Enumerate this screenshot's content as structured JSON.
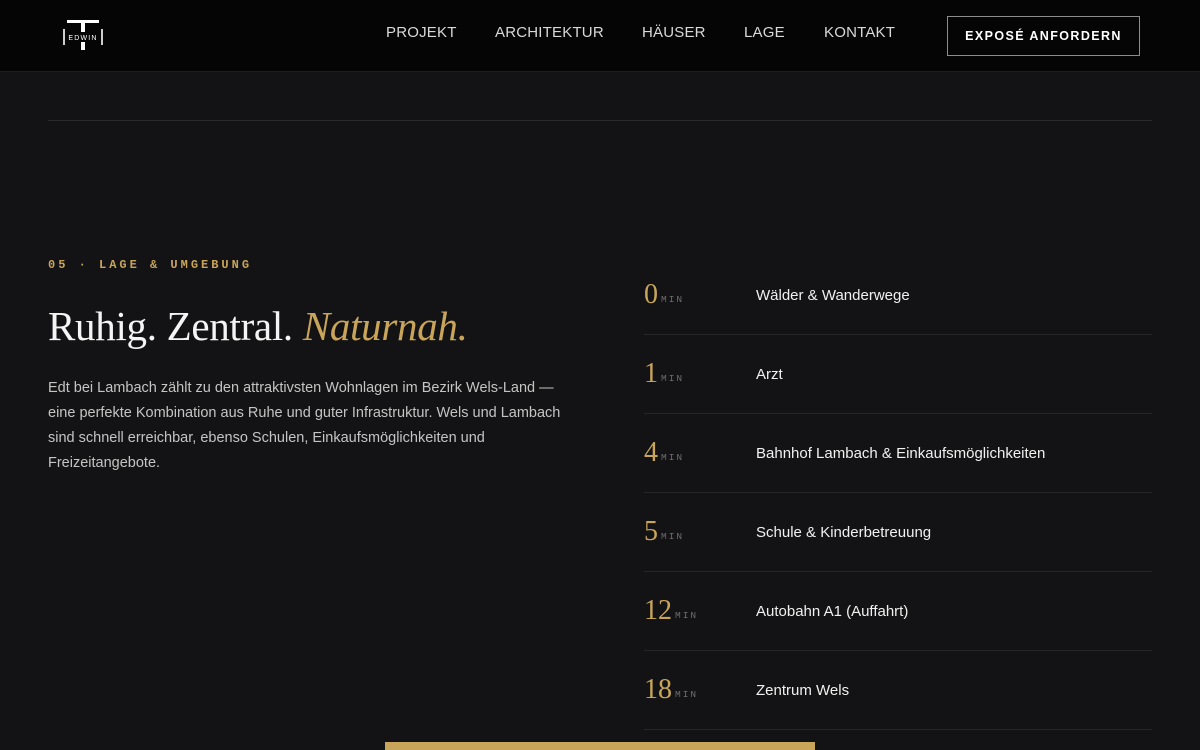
{
  "header": {
    "logo_text": "EDWIN",
    "nav": [
      {
        "label": "PROJEKT"
      },
      {
        "label": "ARCHITEKTUR"
      },
      {
        "label": "HÄUSER"
      },
      {
        "label": "LAGE"
      },
      {
        "label": "KONTAKT"
      }
    ],
    "cta_label": "EXPOSÉ ANFORDERN"
  },
  "section": {
    "eyebrow": "05 · LAGE & UMGEBUNG",
    "heading_plain": "Ruhig. Zentral.",
    "heading_accent": "Naturnah.",
    "intro": "Edt bei Lambach zählt zu den attraktivsten Wohnlagen im Bezirk Wels-Land — eine perfekte Kombination aus Ruhe und guter Infrastruktur. Wels und Lambach sind schnell erreichbar, ebenso Schulen, Einkaufsmöglichkeiten und Freizeitangebote."
  },
  "poi": [
    {
      "minutes": "0",
      "unit": "MIN",
      "label": "Wälder & Wanderwege"
    },
    {
      "minutes": "1",
      "unit": "MIN",
      "label": "Arzt"
    },
    {
      "minutes": "4",
      "unit": "MIN",
      "label": "Bahnhof Lambach & Einkaufsmöglichkeiten"
    },
    {
      "minutes": "5",
      "unit": "MIN",
      "label": "Schule & Kinderbetreuung"
    },
    {
      "minutes": "12",
      "unit": "MIN",
      "label": "Autobahn A1 (Auffahrt)"
    },
    {
      "minutes": "18",
      "unit": "MIN",
      "label": "Zentrum Wels"
    }
  ],
  "colors": {
    "background": "#131315",
    "header_bg": "#050505",
    "accent_gold": "#c9a55a",
    "text_primary": "#f0f0f0",
    "text_muted": "#c4c4c4"
  }
}
